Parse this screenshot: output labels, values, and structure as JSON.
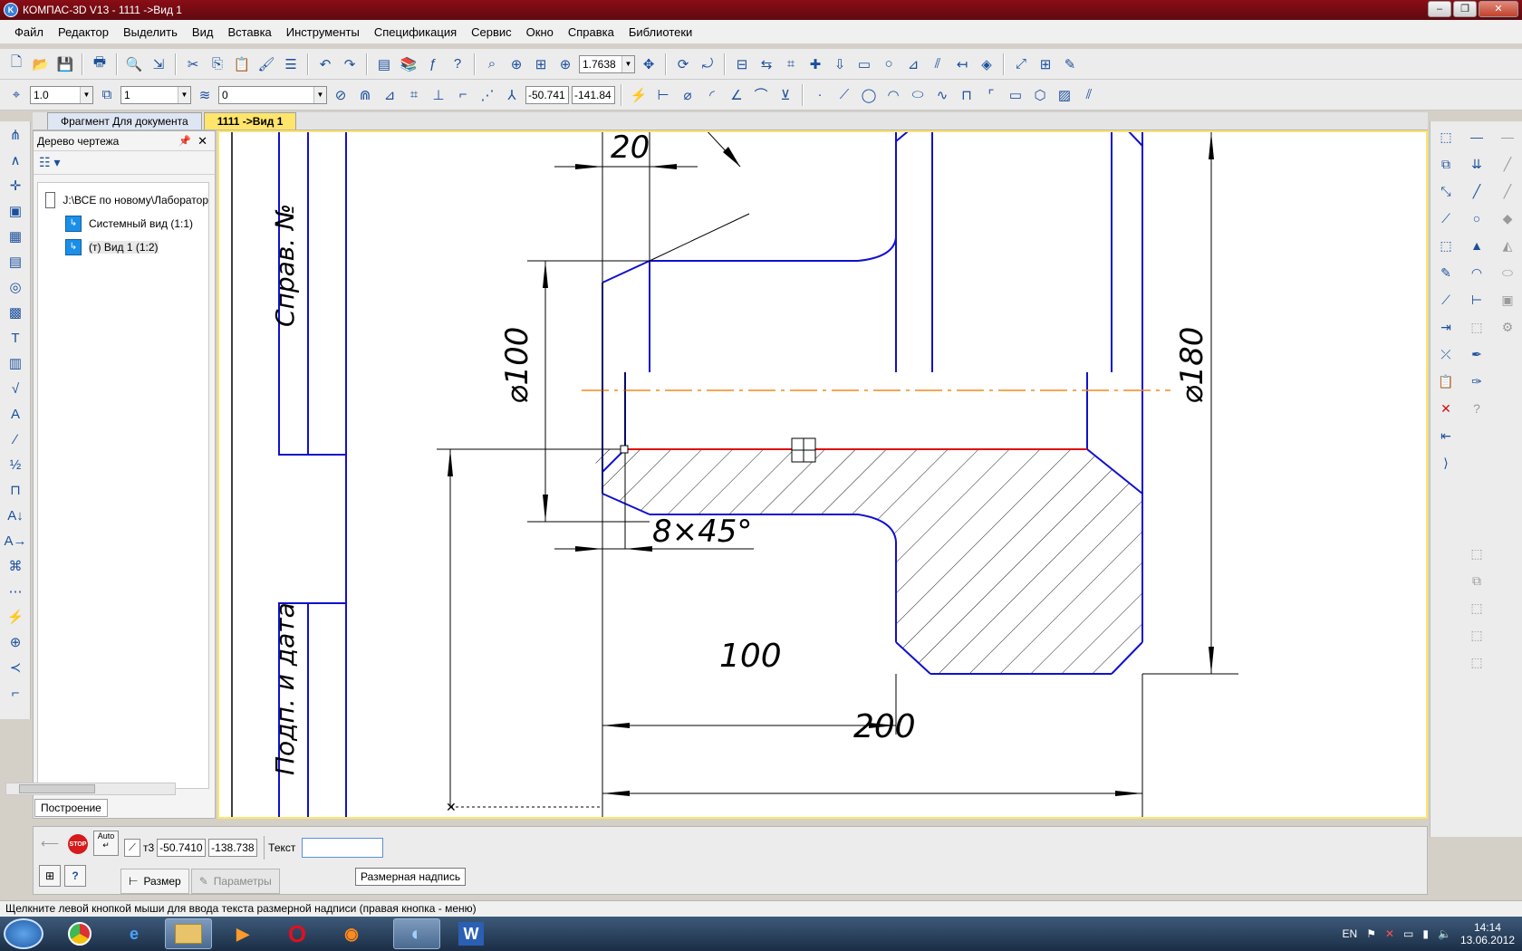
{
  "window": {
    "title": "КОМПАС-3D V13 - 1111 ->Вид 1",
    "app_icon": "K"
  },
  "menu": [
    "Файл",
    "Редактор",
    "Выделить",
    "Вид",
    "Вставка",
    "Инструменты",
    "Спецификация",
    "Сервис",
    "Окно",
    "Справка",
    "Библиотеки"
  ],
  "toolbar1": {
    "zoom_value": "1.7638"
  },
  "toolbar2": {
    "step_value": "1.0",
    "layer_value": "1",
    "style_value": "0",
    "coord_x": "-50.741",
    "coord_y": "-141.84"
  },
  "tabs": [
    {
      "label": "Фрагмент Для документа",
      "active": false
    },
    {
      "label": "1111 ->Вид 1",
      "active": true
    }
  ],
  "tree": {
    "title": "Дерево чертежа",
    "rows": [
      {
        "label": "J:\\ВСЕ по новому\\Лаборатор",
        "type": "file"
      },
      {
        "label": "Системный вид (1:1)",
        "type": "view"
      },
      {
        "label": "(т) Вид 1 (1:2)",
        "type": "view"
      }
    ],
    "bottom_tab": "Построение"
  },
  "drawing": {
    "dim_top": "20",
    "dim_d100": "⌀100",
    "dim_chamfer": "8×45°",
    "dim_100": "100",
    "dim_200": "200",
    "dim_d180": "⌀180",
    "stamp_upper": "Справ. №",
    "stamp_lower": "Подп. и дата",
    "colors": {
      "contour": "#1010d0",
      "hatch": "#202020",
      "axis": "#f08a1e",
      "highlight": "#e01010",
      "dim": "#000000"
    }
  },
  "properties": {
    "stop_label": "STOP",
    "auto_label": "Auto",
    "point_label": "т3",
    "x_value": "-50.7410",
    "y_value": "-138.738",
    "text_label": "Текст",
    "text_value": "",
    "tabs": [
      {
        "label": "Размер",
        "active": true
      },
      {
        "label": "Параметры",
        "active": false
      }
    ]
  },
  "tooltip": "Размерная надпись",
  "status": "Щелкните левой кнопкой мыши для ввода текста размерной надписи (правая кнопка - меню)",
  "taskbar": {
    "apps": [
      "chrome",
      "ie",
      "explorer",
      "media",
      "opera",
      "firefox",
      "kompas",
      "word"
    ],
    "language": "EN",
    "time": "14:14",
    "date": "13.06.2012"
  }
}
